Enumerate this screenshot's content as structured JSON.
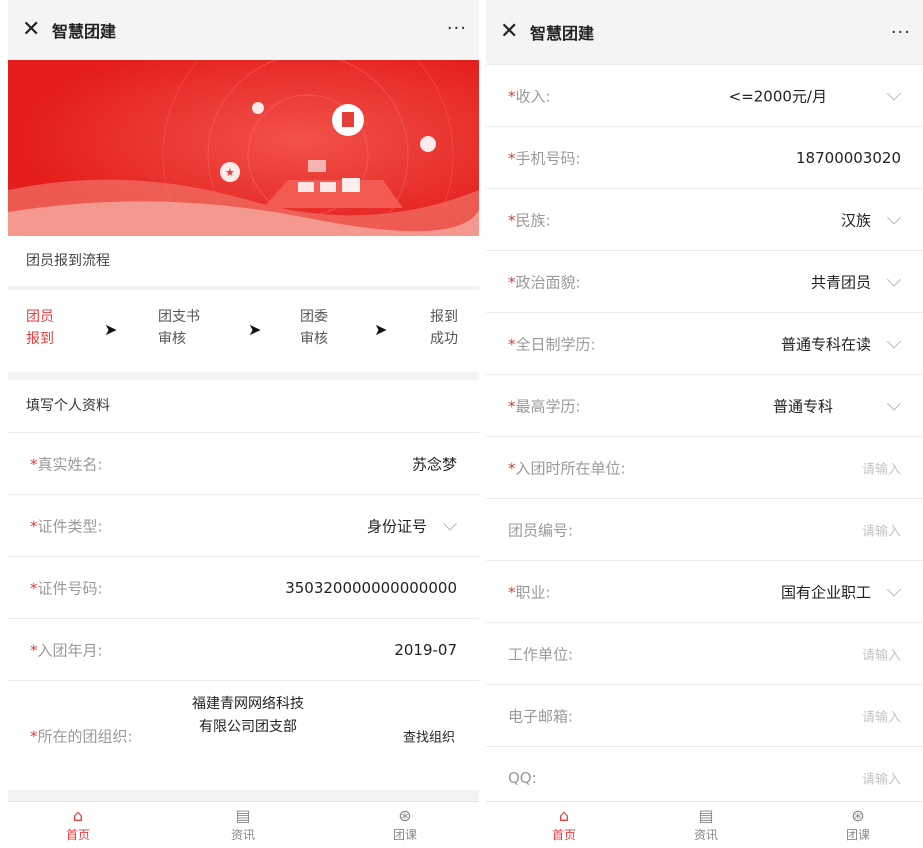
{
  "left": {
    "app_title": "智慧团建",
    "more_label": "···",
    "process_title": "团员报到流程",
    "steps": [
      {
        "line1": "团员",
        "line2": "报到"
      },
      {
        "line1": "团支书",
        "line2": "审核"
      },
      {
        "line1": "团委",
        "line2": "审核"
      },
      {
        "line1": "报到",
        "line2": "成功"
      }
    ],
    "arrow": "➤",
    "form_title": "填写个人资料",
    "star": "*",
    "fields": {
      "name": {
        "label": "真实姓名:",
        "value": "苏念梦"
      },
      "id_type": {
        "label": "证件类型:",
        "value": "身份证号"
      },
      "id_number": {
        "label": "证件号码:",
        "value": "350320000000000000"
      },
      "join_date": {
        "label": "入团年月:",
        "value": "2019-07"
      },
      "org": {
        "label": "所在的团组织:",
        "value": "福建青网网络科技有限公司团支部",
        "action": "查找组织"
      }
    },
    "tabs": [
      {
        "label": "首页",
        "icon": "home-icon"
      },
      {
        "label": "资讯",
        "icon": "news-icon"
      },
      {
        "label": "团课",
        "icon": "course-icon"
      }
    ]
  },
  "right": {
    "app_title": "智慧团建",
    "more_label": "···",
    "star": "*",
    "fields": {
      "income": {
        "label": "收入:",
        "value": "<=2000元/月"
      },
      "phone": {
        "label": "手机号码:",
        "value": "18700003020"
      },
      "ethnicity": {
        "label": "民族:",
        "value": "汉族"
      },
      "political": {
        "label": "政治面貌:",
        "value": "共青团员"
      },
      "fulltime_edu": {
        "label": "全日制学历:",
        "value": "普通专科在读"
      },
      "highest_edu": {
        "label": "最高学历:",
        "value": "普通专科"
      },
      "join_unit": {
        "label": "入团时所在单位:",
        "placeholder": "请输入"
      },
      "member_no": {
        "label": "团员编号:",
        "placeholder": "请输入"
      },
      "occupation": {
        "label": "职业:",
        "value": "国有企业职工"
      },
      "work_unit": {
        "label": "工作单位:",
        "placeholder": "请输入"
      },
      "email": {
        "label": "电子邮箱:",
        "placeholder": "请输入"
      },
      "qq": {
        "label": "QQ:",
        "placeholder": "请输入"
      }
    },
    "tabs": [
      {
        "label": "首页",
        "icon": "home-icon"
      },
      {
        "label": "资讯",
        "icon": "news-icon"
      },
      {
        "label": "团课",
        "icon": "course-icon"
      }
    ]
  },
  "colors": {
    "accent": "#e63d39",
    "banner_red": "#e9231f"
  }
}
